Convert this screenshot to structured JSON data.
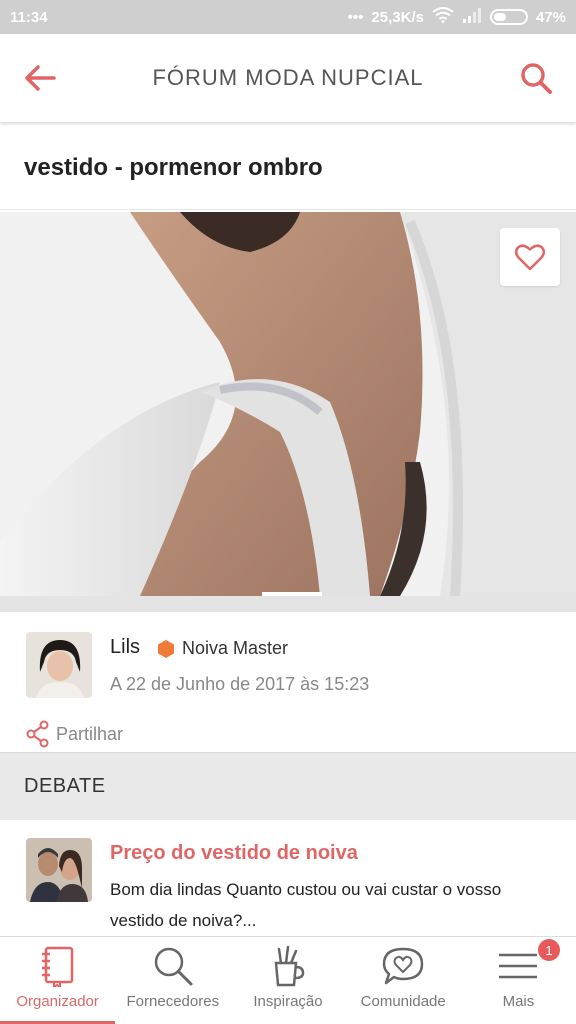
{
  "status_bar": {
    "time": "11:34",
    "speed": "25,3K/s",
    "battery": "47%"
  },
  "header": {
    "title": "FÓRUM MODA NUPCIAL",
    "back_icon": "arrow-left-icon",
    "search_icon": "search-icon"
  },
  "post": {
    "title": "vestido - pormenor ombro"
  },
  "author": {
    "name": "Lils",
    "badge": "Noiva Master",
    "date": "A 22 de Junho de 2017 às 15:23"
  },
  "share_label": "Partilhar",
  "debate": {
    "section_title": "DEBATE",
    "items": [
      {
        "title": "Preço do vestido de noiva",
        "excerpt": "Bom dia lindas Quanto custou ou vai custar o vosso vestido de noiva?..."
      }
    ]
  },
  "bottom_nav": [
    {
      "label": "Organizador",
      "icon": "notebook-icon",
      "active": true
    },
    {
      "label": "Fornecedores",
      "icon": "search-icon",
      "active": false
    },
    {
      "label": "Inspiração",
      "icon": "brush-cup-icon",
      "active": false
    },
    {
      "label": "Comunidade",
      "icon": "chat-heart-icon",
      "active": false
    },
    {
      "label": "Mais",
      "icon": "menu-icon",
      "active": false,
      "badge": "1"
    }
  ],
  "colors": {
    "accent": "#e06666",
    "badge_orange": "#f07a3a"
  }
}
